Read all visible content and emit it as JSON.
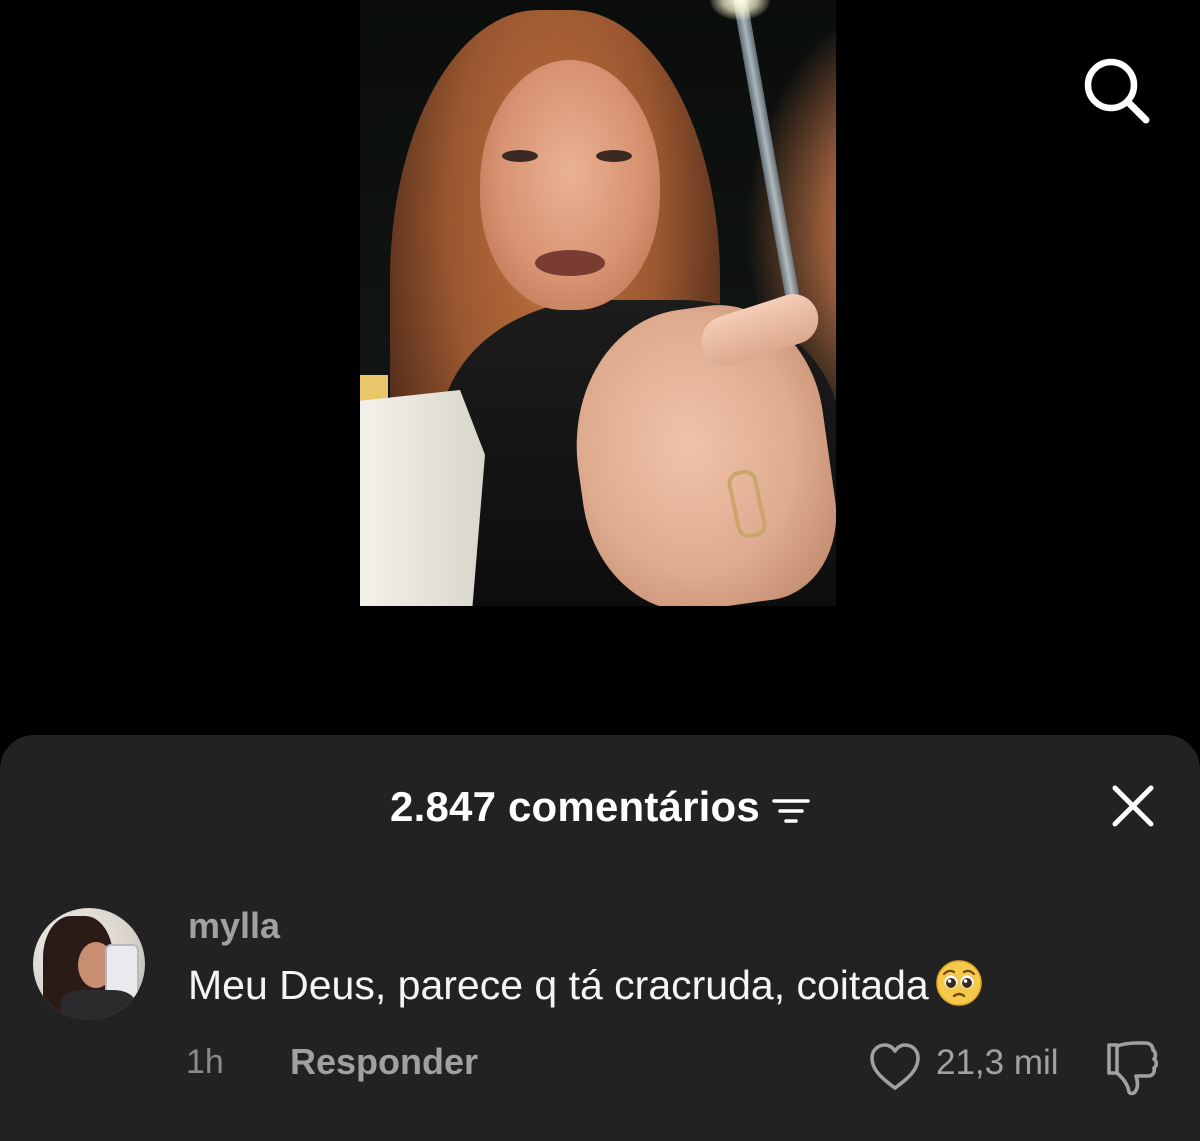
{
  "header": {
    "search_icon": "search-icon"
  },
  "comments_sheet": {
    "title": "2.847 comentários",
    "filter_icon": "filter-icon",
    "close_icon": "close-icon",
    "background": "#222223"
  },
  "comment": {
    "username": "mylla",
    "text": "Meu Deus, parece q tá cracruda, coitada",
    "emoji": "pleading-face-emoji",
    "time": "1h",
    "reply_label": "Responder",
    "like_count": "21,3 mil",
    "like_icon": "heart-icon",
    "dislike_icon": "thumbs-down-icon"
  }
}
